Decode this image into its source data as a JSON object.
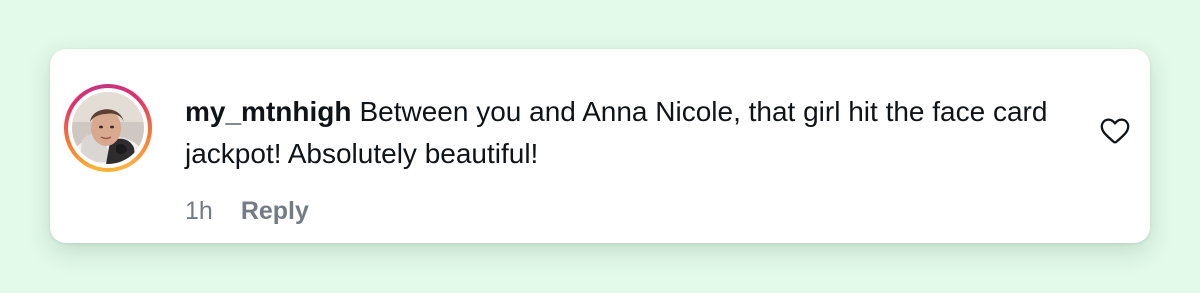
{
  "comment": {
    "username": "my_mtnhigh",
    "text": "Between you and Anna Nicole, that girl hit the face card jackpot! Absolutely beautiful!",
    "time": "1h",
    "reply_label": "Reply",
    "avatar_icon": "user-avatar-photo",
    "like_icon": "heart-outline-icon"
  },
  "colors": {
    "page_background": "#e3f9ea",
    "card_background": "#ffffff",
    "text": "#0f1419",
    "muted": "#737c85",
    "story_ring_start": "#f9b233",
    "story_ring_end": "#c13584"
  }
}
